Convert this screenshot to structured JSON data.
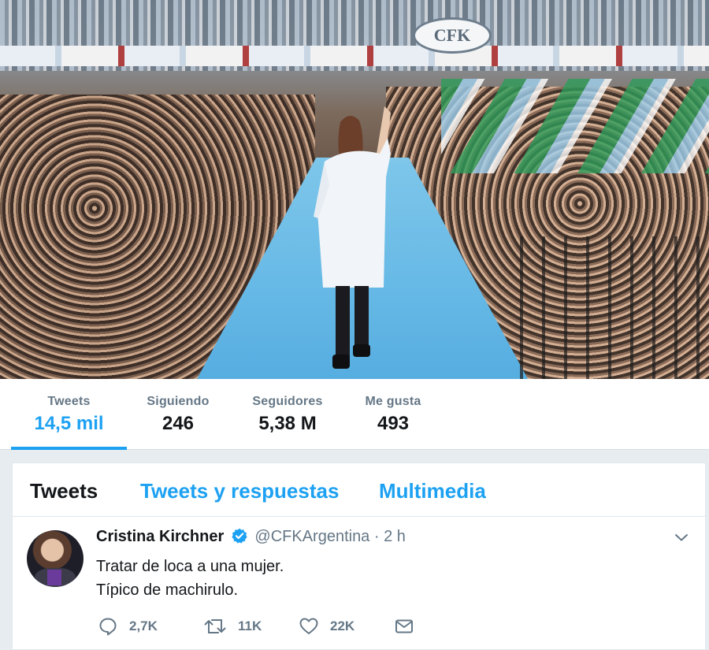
{
  "banner": {
    "badge_text": "CFK"
  },
  "stats": [
    {
      "label": "Tweets",
      "value": "14,5 mil",
      "active": true
    },
    {
      "label": "Siguiendo",
      "value": "246"
    },
    {
      "label": "Seguidores",
      "value": "5,38 M"
    },
    {
      "label": "Me gusta",
      "value": "493"
    }
  ],
  "tabs": [
    {
      "label": "Tweets",
      "selected": true
    },
    {
      "label": "Tweets y respuestas"
    },
    {
      "label": "Multimedia"
    }
  ],
  "tweet": {
    "author": "Cristina Kirchner",
    "handle": "@CFKArgentina",
    "separator": "·",
    "time": "2 h",
    "text_lines": [
      "Tratar de loca a una mujer.",
      "Típico de machirulo."
    ],
    "actions": {
      "reply": {
        "icon": "reply-icon",
        "count": "2,7K"
      },
      "retweet": {
        "icon": "retweet-icon",
        "count": "11K"
      },
      "like": {
        "icon": "heart-icon",
        "count": "22K"
      },
      "message": {
        "icon": "envelope-icon"
      }
    }
  },
  "colors": {
    "accent": "#1da1f2",
    "text": "#14171a",
    "muted": "#657786",
    "background": "#e6ecf0"
  }
}
